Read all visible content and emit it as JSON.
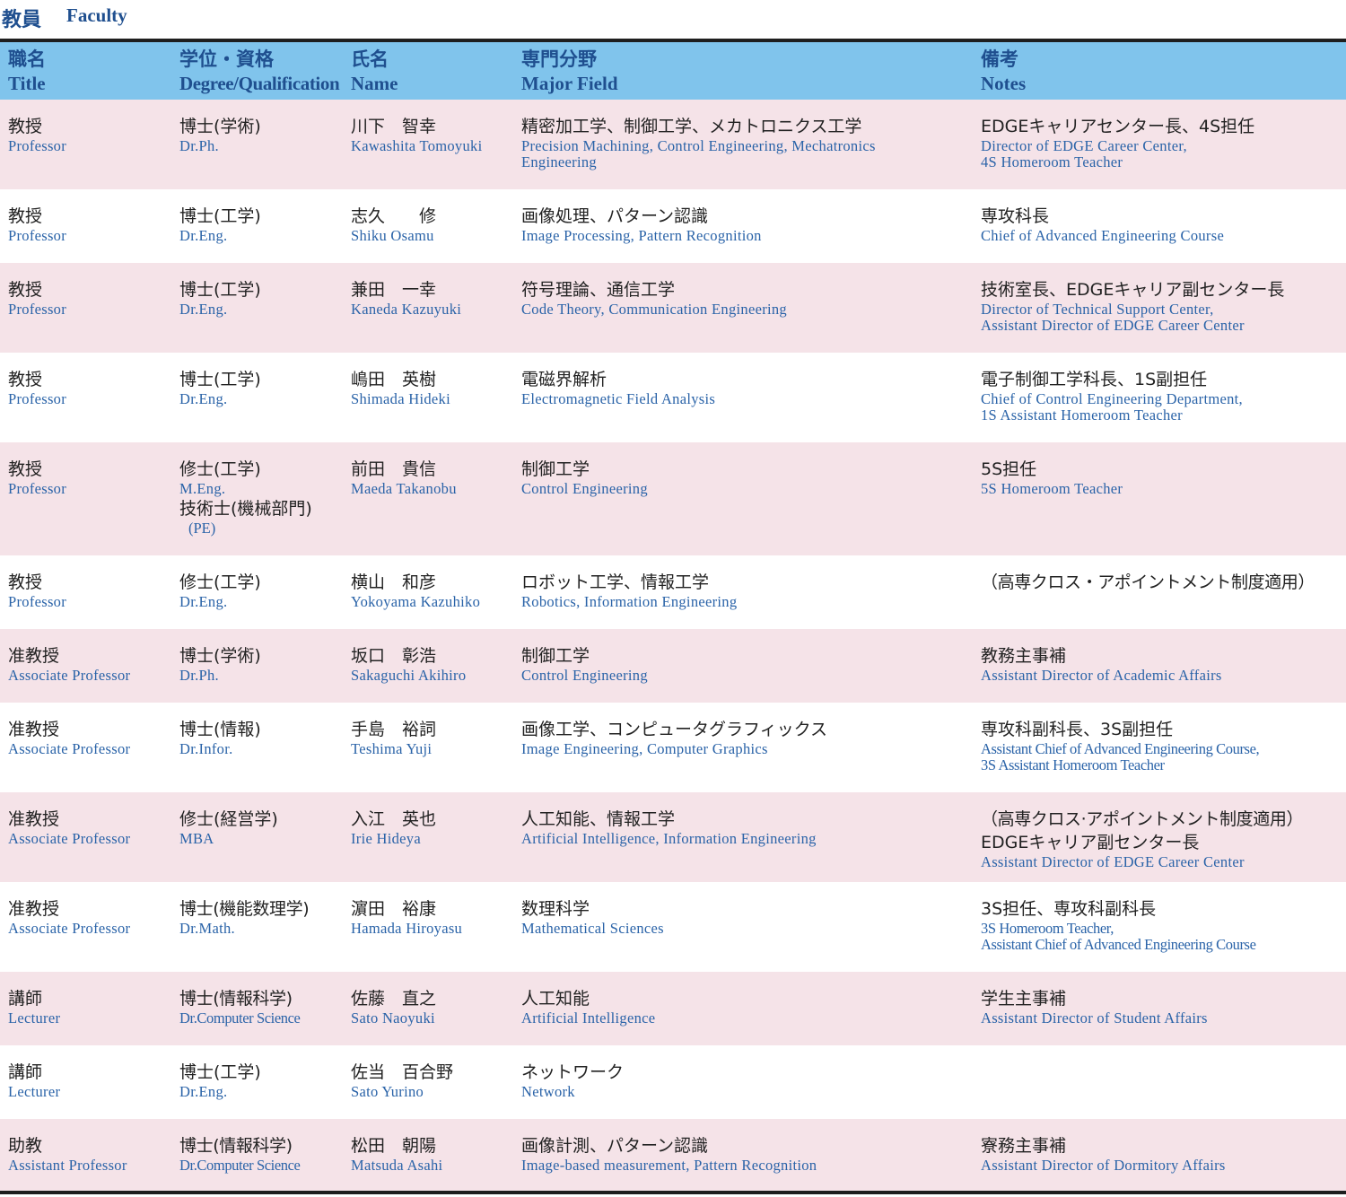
{
  "title": {
    "jp": "教員",
    "en": "Faculty"
  },
  "header": {
    "title": {
      "jp": "職名",
      "en": "Title"
    },
    "degree": {
      "jp": "学位・資格",
      "en": "Degree/Qualification"
    },
    "name": {
      "jp": "氏名",
      "en": "Name"
    },
    "field": {
      "jp": "専門分野",
      "en": "Major Field"
    },
    "notes": {
      "jp": "備考",
      "en": "Notes"
    }
  },
  "rows": [
    {
      "title_jp": "教授",
      "title_en": "Professor",
      "degree_jp": "博士(学術)",
      "degree_en": "Dr.Ph.",
      "name_jp": "川下　智幸",
      "name_en": "Kawashita Tomoyuki",
      "field_jp": "精密加工学、制御工学、メカトロニクス工学",
      "field_en": "Precision  Machining,  Control  Engineering,  Mechatronics\nEngineering",
      "notes_jp": "EDGEキャリアセンター長、4S担任",
      "notes_en": "Director of EDGE Career Center,\n4S Homeroom Teacher"
    },
    {
      "title_jp": "教授",
      "title_en": "Professor",
      "degree_jp": "博士(工学)",
      "degree_en": "Dr.Eng.",
      "name_jp": "志久　　修",
      "name_en": "Shiku Osamu",
      "field_jp": "画像処理、パターン認識",
      "field_en": "Image Processing, Pattern Recognition",
      "notes_jp": "専攻科長",
      "notes_en": "Chief of Advanced Engineering Course"
    },
    {
      "title_jp": "教授",
      "title_en": "Professor",
      "degree_jp": "博士(工学)",
      "degree_en": "Dr.Eng.",
      "name_jp": "兼田　一幸",
      "name_en": "Kaneda Kazuyuki",
      "field_jp": "符号理論、通信工学",
      "field_en": "Code Theory, Communication Engineering",
      "notes_jp": "技術室長、EDGEキャリア副センター長",
      "notes_en": "Director of Technical Support Center,\nAssistant Director of EDGE Career Center"
    },
    {
      "title_jp": "教授",
      "title_en": "Professor",
      "degree_jp": "博士(工学)",
      "degree_en": "Dr.Eng.",
      "name_jp": "嶋田　英樹",
      "name_en": "Shimada Hideki",
      "field_jp": "電磁界解析",
      "field_en": "Electromagnetic Field Analysis",
      "notes_jp": "電子制御工学科長、1S副担任",
      "notes_en": "Chief of Control Engineering Department,\n1S Assistant Homeroom Teacher"
    },
    {
      "title_jp": "教授",
      "title_en": "Professor",
      "degree_jp": "修士(工学)",
      "degree_en": "M.Eng.",
      "degree_jp2": "技術士(機械部門)",
      "degree_en2": "(PE)",
      "name_jp": "前田　貴信",
      "name_en": "Maeda Takanobu",
      "field_jp": "制御工学",
      "field_en": "Control Engineering",
      "notes_jp": "5S担任",
      "notes_en": "5S Homeroom Teacher"
    },
    {
      "title_jp": "教授",
      "title_en": "Professor",
      "degree_jp": "修士(工学)",
      "degree_en": "Dr.Eng.",
      "name_jp": "横山　和彦",
      "name_en": "Yokoyama Kazuhiko",
      "field_jp": "ロボット工学、情報工学",
      "field_en": "Robotics,  Information Engineering",
      "notes_jp": "（高専クロス・アポイントメント制度適用）",
      "notes_en": ""
    },
    {
      "title_jp": "准教授",
      "title_en": "Associate Professor",
      "degree_jp": "博士(学術)",
      "degree_en": "Dr.Ph.",
      "name_jp": "坂口　彰浩",
      "name_en": "Sakaguchi Akihiro",
      "field_jp": "制御工学",
      "field_en": "Control Engineering",
      "notes_jp": "教務主事補",
      "notes_en": "Assistant Director of Academic Affairs"
    },
    {
      "title_jp": "准教授",
      "title_en": "Associate Professor",
      "degree_jp": "博士(情報)",
      "degree_en": "Dr.Infor.",
      "name_jp": "手島　裕詞",
      "name_en": "Teshima Yuji",
      "field_jp": "画像工学、コンピュータグラフィックス",
      "field_en": "Image Engineering, Computer Graphics",
      "notes_jp": "専攻科副科長、3S副担任",
      "notes_en": "Assistant Chief of Advanced Engineering Course,\n3S Assistant Homeroom Teacher"
    },
    {
      "title_jp": "准教授",
      "title_en": "Associate Professor",
      "degree_jp": "修士(経営学)",
      "degree_en": "MBA",
      "name_jp": "入江　英也",
      "name_en": "Irie Hideya",
      "field_jp": "人工知能、情報工学",
      "field_en": "Artificial Intelligence, Information Engineering",
      "notes_jp": "（高専クロス·アポイントメント制度適用）",
      "notes_jp2": "EDGEキャリア副センター長",
      "notes_en": "Assistant Director of EDGE Career Center"
    },
    {
      "title_jp": "准教授",
      "title_en": "Associate Professor",
      "degree_jp": "博士(機能数理学)",
      "degree_en": "Dr.Math.",
      "name_jp": "濵田　裕康",
      "name_en": "Hamada Hiroyasu",
      "field_jp": "数理科学",
      "field_en": "Mathematical Sciences",
      "notes_jp": "3S担任、専攻科副科長",
      "notes_en": "3S Homeroom Teacher,\nAssistant Chief of Advanced Engineering Course"
    },
    {
      "title_jp": "講師",
      "title_en": "Lecturer",
      "degree_jp": "博士(情報科学)",
      "degree_en": "Dr.Computer Science",
      "name_jp": "佐藤　直之",
      "name_en": "Sato Naoyuki",
      "field_jp": "人工知能",
      "field_en": "Artificial Intelligence",
      "notes_jp": "学生主事補",
      "notes_en": "Assistant Director of Student Affairs"
    },
    {
      "title_jp": "講師",
      "title_en": "Lecturer",
      "degree_jp": "博士(工学)",
      "degree_en": "Dr.Eng.",
      "name_jp": "佐当　百合野",
      "name_en": "Sato Yurino",
      "field_jp": "ネットワーク",
      "field_en": "Network",
      "notes_jp": "",
      "notes_en": ""
    },
    {
      "title_jp": "助教",
      "title_en": "Assistant Professor",
      "degree_jp": "博士(情報科学)",
      "degree_en": "Dr.Computer Science",
      "name_jp": "松田　朝陽",
      "name_en": "Matsuda Asahi",
      "field_jp": "画像計測、パターン認識",
      "field_en": "Image-based measurement, Pattern Recognition",
      "notes_jp": "寮務主事補",
      "notes_en": "Assistant Director of Dormitory Affairs"
    }
  ]
}
